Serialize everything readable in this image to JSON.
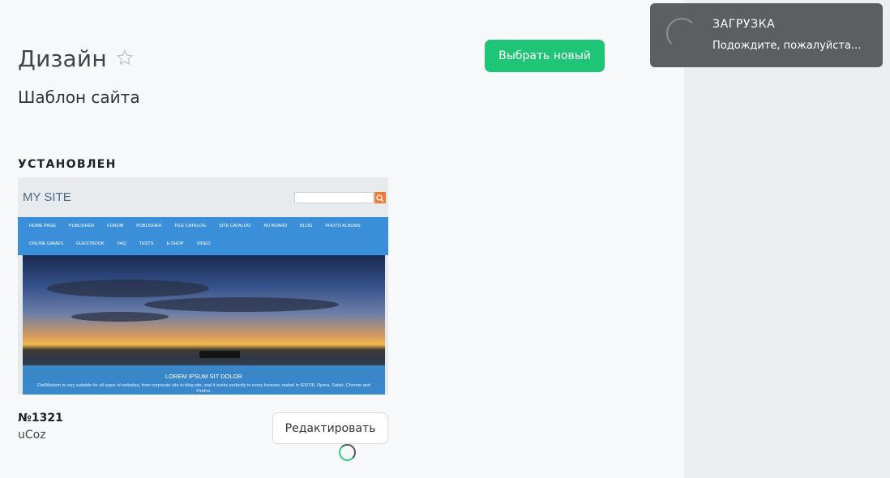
{
  "header": {
    "title": "Дизайн",
    "subtitle": "Шаблон сайта",
    "choose_new_label": "Выбрать новый"
  },
  "installed": {
    "section_label": "УСТАНОВЛЕН",
    "template_number": "№1321",
    "template_vendor": "uCoz",
    "edit_label": "Редактировать",
    "preview": {
      "site_title": "MY SITE",
      "nav_row1": [
        "HOME PAGE",
        "PUBLISHER",
        "FORUM",
        "PUBLISHER",
        "FILE CATALOG",
        "SITE CATALOG",
        "AD BOARD",
        "BLOG",
        "PHOTO ALBUMS"
      ],
      "nav_row2": [
        "ONLINE GAMES",
        "GUESTBOOK",
        "FAQ",
        "TESTS",
        "E-SHOP",
        "VIDEO"
      ],
      "caption_title": "LOREM IPSUM SIT DOLOR",
      "caption_text": "FlatWisdom is very suitable for all types of websites, from corporate site to blog site, and it works perfectly in every browser, tested in IE6/7/8, Opera, Safari, Chrome and Firefox."
    }
  },
  "toast": {
    "title": "ЗАГРУЗКА",
    "message": "Подождите, пожалуйста..."
  },
  "colors": {
    "accent": "#1ec577",
    "toast_bg": "#5c5f62",
    "nav_blue": "#3a8fd8"
  },
  "icons": {
    "favorite": "star-outline-icon",
    "search": "search-icon",
    "loading": "spinner-icon"
  }
}
